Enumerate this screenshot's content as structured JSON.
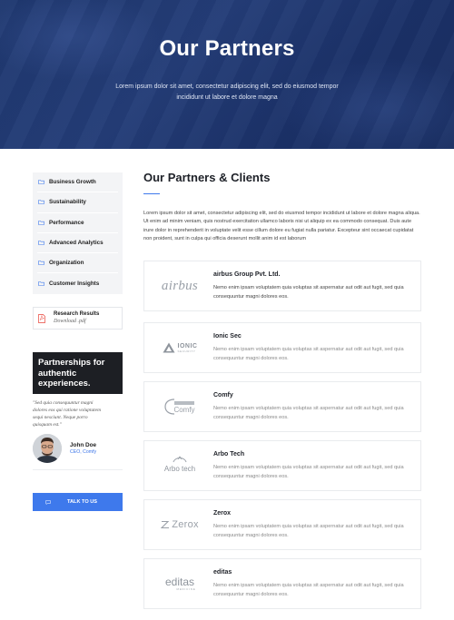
{
  "hero": {
    "title": "Our Partners",
    "subtitle": "Lorem ipsum dolor sit amet, consectetur adipiscing elit, sed do eiusmod tempor incididunt ut labore et dolore magna"
  },
  "sidebar": {
    "items": [
      {
        "label": "Business Growth",
        "icon": "folder-icon"
      },
      {
        "label": "Sustainability",
        "icon": "folder-icon"
      },
      {
        "label": "Performance",
        "icon": "folder-icon"
      },
      {
        "label": "Advanced Analytics",
        "icon": "folder-icon"
      },
      {
        "label": "Organization",
        "icon": "folder-icon"
      },
      {
        "label": "Customer Insights",
        "icon": "folder-icon"
      }
    ],
    "research": {
      "title": "Research Results",
      "subtitle": "Download .pdf",
      "icon": "pdf-icon"
    },
    "promo": "Partnerships for authentic experiences.",
    "quote": "\"Sed quia consequuntur magni dolores eos qui ratione voluptatem sequi nesciunt. Neque porro quisquam est.\"",
    "author": {
      "name": "John Doe",
      "role": "CEO, Comfy"
    },
    "cta": "TALK TO US"
  },
  "main": {
    "title": "Our Partners & Clients",
    "intro": "Lorem ipsum dolor sit amet, consectetur adipiscing elit, sed do eiusmod tempor incididunt ut labore et dolore magna aliqua. Ut enim ad minim veniam, quis nostrud exercitation ullamco laboris nisi ut aliquip ex ea commodo consequat. Duis aute irure dolor in reprehenderit in voluptate velit esse cillum dolore eu fugiat nulla pariatur. Excepteur sint occaecat cupidatat non proident, sunt in culpa qui officia deserunt mollit anim id est laborum",
    "partners": [
      {
        "name": "airbus Group Pvt. Ltd.",
        "logo": "airbus",
        "logo_sub": "",
        "description": "Nemo enim ipsam voluptatem quia voluptas sit aspernatur aut odit aut fugit, sed quia consequuntur magni dolores eos."
      },
      {
        "name": "Ionic Sec",
        "logo": "IONIC",
        "logo_sub": "SECURITY",
        "description": "Nemo enim ipsam voluptatem quia voluptas sit aspernatur aut odit aut fugit, sed quia consequuntur magni dolores eos."
      },
      {
        "name": "Comfy",
        "logo": "Comfy",
        "logo_sub": "",
        "description": "Nemo enim ipsam voluptatem quia voluptas sit aspernatur aut odit aut fugit, sed quia consequuntur magni dolores eos."
      },
      {
        "name": "Arbo Tech",
        "logo": "Arbo tech",
        "logo_sub": "",
        "description": "Nemo enim ipsam voluptatem quia voluptas sit aspernatur aut odit aut fugit, sed quia consequuntur magni dolores eos."
      },
      {
        "name": "Zerox",
        "logo": "Zerox",
        "logo_sub": "",
        "description": "Nemo enim ipsam voluptatem quia voluptas sit aspernatur aut odit aut fugit, sed quia consequuntur magni dolores eos."
      },
      {
        "name": "editas",
        "logo": "editas",
        "logo_sub": "MEDICINE",
        "description": "Nemo enim ipsam voluptatem quia voluptas sit aspernatur aut odit aut fugit, sed quia consequuntur magni dolores eos."
      }
    ]
  },
  "colors": {
    "accent": "#3e79ec",
    "hero": "#1f3870",
    "dark_box": "#1d1f24",
    "pdf": "#e8443a"
  }
}
